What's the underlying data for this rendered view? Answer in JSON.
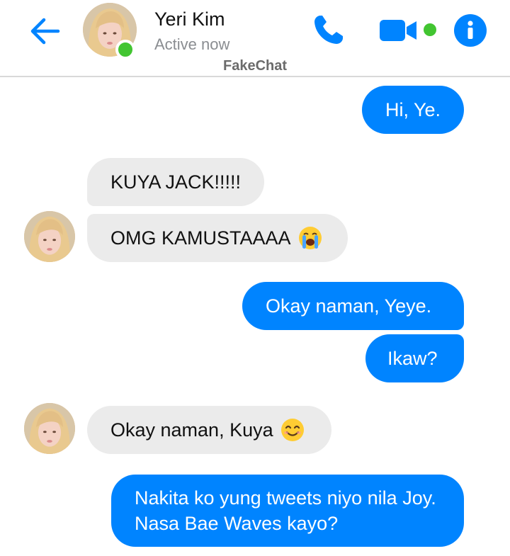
{
  "header": {
    "contact_name": "Yeri Kim",
    "status": "Active now",
    "watermark": "FakeChat",
    "icons": [
      "back-arrow-icon",
      "phone-icon",
      "video-camera-icon",
      "info-icon"
    ],
    "accent_color": "#0084ff",
    "online_color": "#42c531"
  },
  "messages": [
    {
      "direction": "outgoing",
      "text": "Hi, Ye."
    },
    {
      "direction": "incoming",
      "text": "KUYA JACK!!!!!"
    },
    {
      "direction": "incoming",
      "text": "OMG KAMUSTAAAA",
      "emoji": "loudly-crying-face-icon"
    },
    {
      "direction": "outgoing",
      "text": "Okay naman, Yeye."
    },
    {
      "direction": "outgoing",
      "text": "Ikaw?"
    },
    {
      "direction": "incoming",
      "text": "Okay naman, Kuya",
      "emoji": "smiling-face-icon"
    },
    {
      "direction": "outgoing",
      "text": "Nakita ko yung tweets niyo nila Joy. Nasa Bae Waves kayo?"
    }
  ],
  "colors": {
    "outgoing_bubble": "#0084ff",
    "incoming_bubble": "#ebebeb"
  }
}
